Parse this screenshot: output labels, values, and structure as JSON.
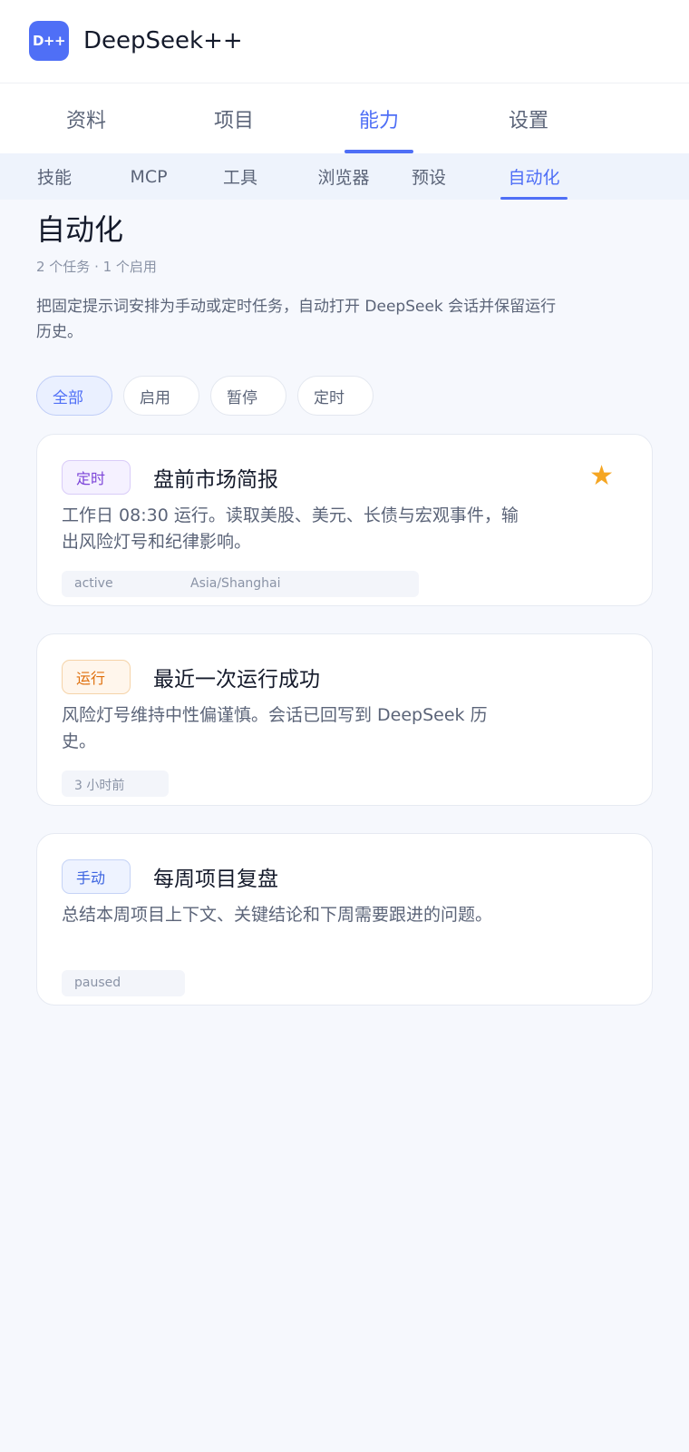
{
  "app": {
    "logo_text": "D++",
    "title": "DeepSeek++"
  },
  "tabs": [
    {
      "label": "资料",
      "active": false
    },
    {
      "label": "项目",
      "active": false
    },
    {
      "label": "能力",
      "active": true
    },
    {
      "label": "设置",
      "active": false
    }
  ],
  "subtabs": [
    {
      "label": "技能",
      "active": false
    },
    {
      "label": "MCP",
      "active": false
    },
    {
      "label": "工具",
      "active": false
    },
    {
      "label": "浏览器",
      "active": false
    },
    {
      "label": "预设",
      "active": false
    },
    {
      "label": "自动化",
      "active": true
    }
  ],
  "page": {
    "title": "自动化",
    "meta": "2 个任务 · 1 个启用",
    "description": "把固定提示词安排为手动或定时任务，自动打开 DeepSeek 会话并保留运行历史。"
  },
  "filters": [
    {
      "label": "全部",
      "active": true
    },
    {
      "label": "启用",
      "active": false
    },
    {
      "label": "暂停",
      "active": false
    },
    {
      "label": "定时",
      "active": false
    }
  ],
  "cards": [
    {
      "badge": "定时",
      "title": "盘前市场简报",
      "description": "工作日 08:30 运行。读取美股、美元、长债与宏观事件，输出风险灯号和纪律影响。",
      "tags": [
        "active",
        "Asia/Shanghai"
      ],
      "starred": true
    },
    {
      "badge": "运行",
      "title": "最近一次运行成功",
      "description": "风险灯号维持中性偏谨慎。会话已回写到 DeepSeek 历史。",
      "tags": [
        "3 小时前"
      ],
      "starred": false
    },
    {
      "badge": "手动",
      "title": "每周项目复盘",
      "description": "总结本周项目上下文、关键结论和下周需要跟进的问题。",
      "tags": [
        "paused"
      ],
      "starred": false
    }
  ],
  "icons": {
    "star": "star-icon",
    "star_color": "#f5a623"
  },
  "colors": {
    "accent": "#4f6ff6",
    "background": "#f6f8fd"
  }
}
